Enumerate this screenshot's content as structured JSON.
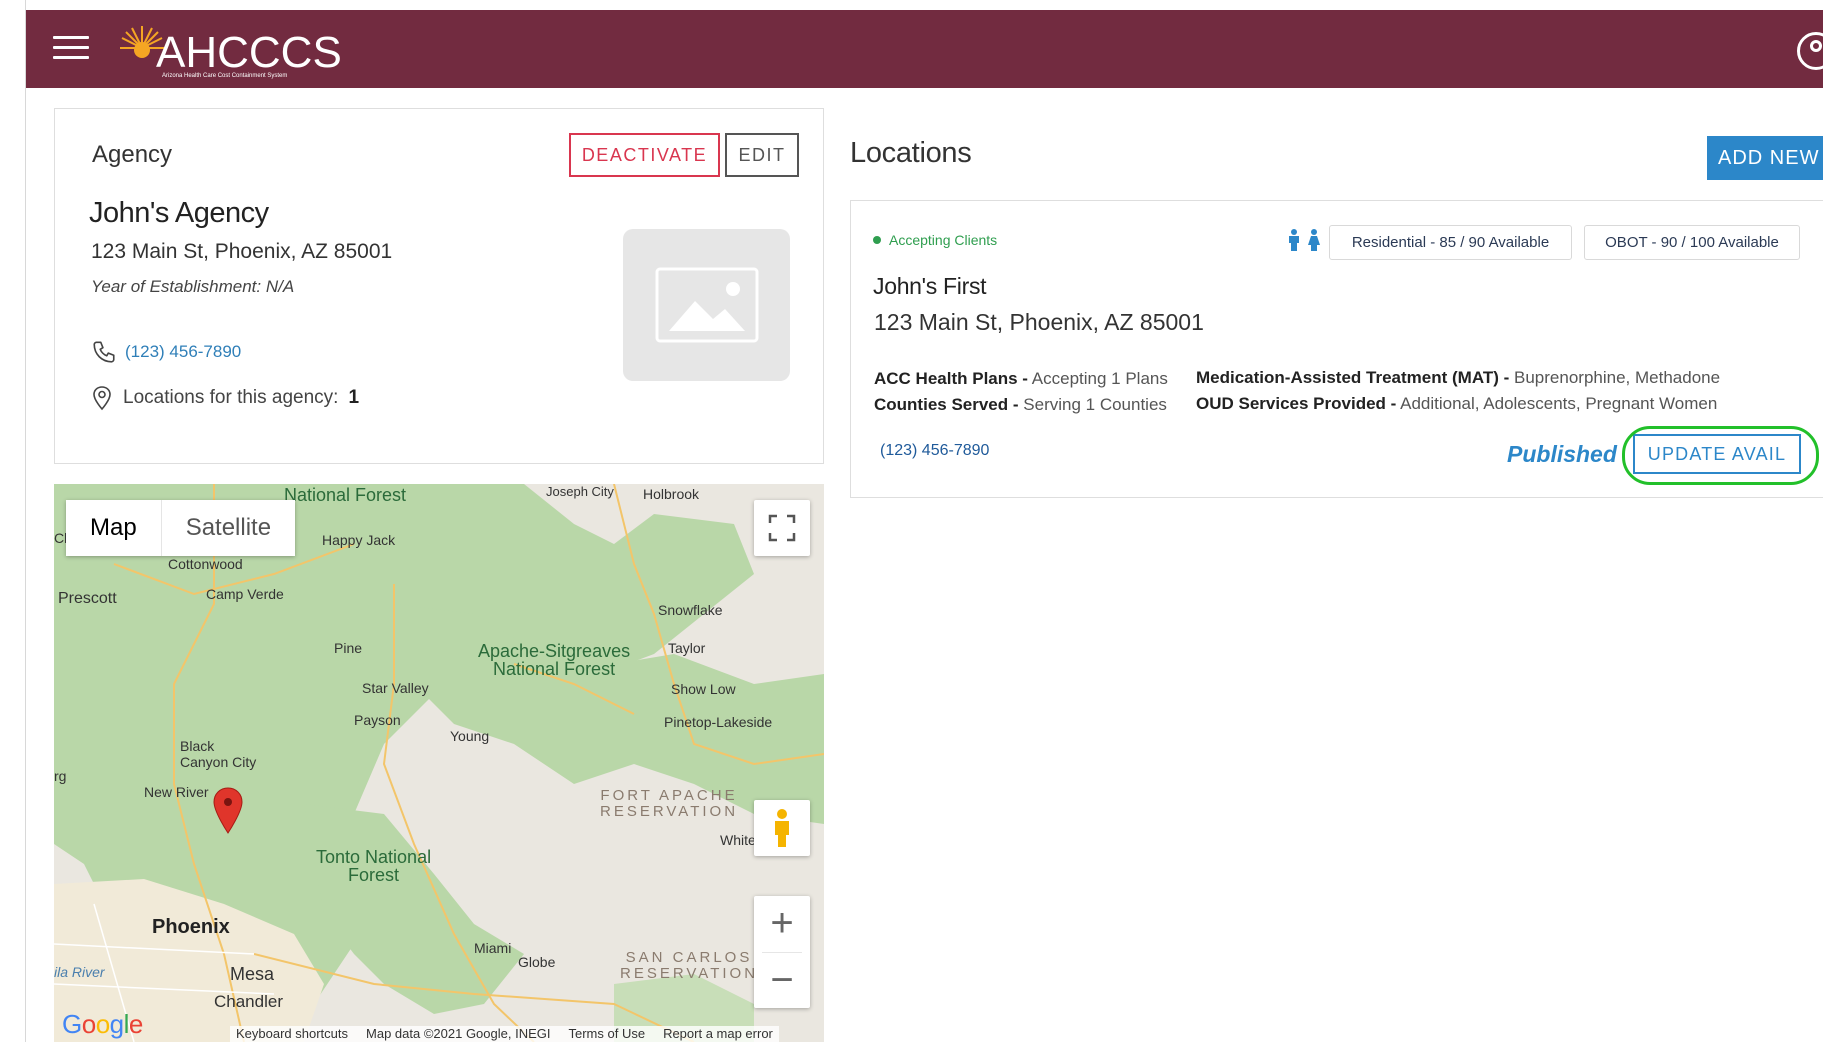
{
  "header": {
    "logo_text": "AHCCCS",
    "logo_subtitle": "Arizona Health Care Cost Containment System",
    "brand_color": "#722b40"
  },
  "agency": {
    "section_label": "Agency",
    "deactivate_label": "DEACTIVATE",
    "edit_label": "EDIT",
    "name": "John's Agency",
    "address": "123 Main St, Phoenix, AZ 85001",
    "year": "Year of Establishment: N/A",
    "phone": "(123) 456-7890",
    "locations_label": "Locations for this agency:",
    "locations_count": "1"
  },
  "map": {
    "map_tab": "Map",
    "satellite_tab": "Satellite",
    "places": {
      "national_forest_top": "National Forest",
      "joseph_city": "Joseph City",
      "holbrook": "Holbrook",
      "happy_jack": "Happy Jack",
      "cottonwood": "Cottonwood",
      "prescott": "Prescott",
      "camp_verde": "Camp Verde",
      "snowflake": "Snowflake",
      "pine": "Pine",
      "apache_sitgreaves": "Apache-Sitgreaves\nNational Forest",
      "taylor": "Taylor",
      "star_valley": "Star Valley",
      "show_low": "Show Low",
      "payson": "Payson",
      "pinetop": "Pinetop-Lakeside",
      "young": "Young",
      "black_canyon": "Black\nCanyon City",
      "new_river": "New River",
      "fort_apache": "FORT APACHE\nRESERVATION",
      "whiteriver": "Whiteriver",
      "tonto": "Tonto National\nForest",
      "phoenix": "Phoenix",
      "mesa": "Mesa",
      "chandler": "Chandler",
      "miami": "Miami",
      "globe": "Globe",
      "san_carlos": "SAN CARLOS\nRESERVATION",
      "gila_river": "ila River",
      "rg": "rg",
      "cl": "Cl"
    },
    "google": "Google",
    "attribution": {
      "shortcuts": "Keyboard shortcuts",
      "map_data": "Map data ©2021 Google, INEGI",
      "terms": "Terms of Use",
      "report": "Report a map error"
    }
  },
  "locations": {
    "title": "Locations",
    "add_new_label": "ADD NEW",
    "items": [
      {
        "status": "Accepting Clients",
        "residential_badge": "Residential - 85 / 90 Available",
        "obot_badge": "OBOT - 90 / 100 Available",
        "name": "John's First",
        "address": "123 Main St, Phoenix, AZ 85001",
        "acc_label": "ACC Health Plans -",
        "acc_value": "Accepting 1 Plans",
        "counties_label": "Counties Served -",
        "counties_value": "Serving 1 Counties",
        "mat_label": "Medication-Assisted Treatment (MAT) -",
        "mat_value": "Buprenorphine, Methadone",
        "oud_label": "OUD Services Provided -",
        "oud_value": "Additional, Adolescents, Pregnant Women",
        "phone": "(123) 456-7890",
        "published": "Published",
        "update_label": "UPDATE AVAIL"
      }
    ]
  }
}
